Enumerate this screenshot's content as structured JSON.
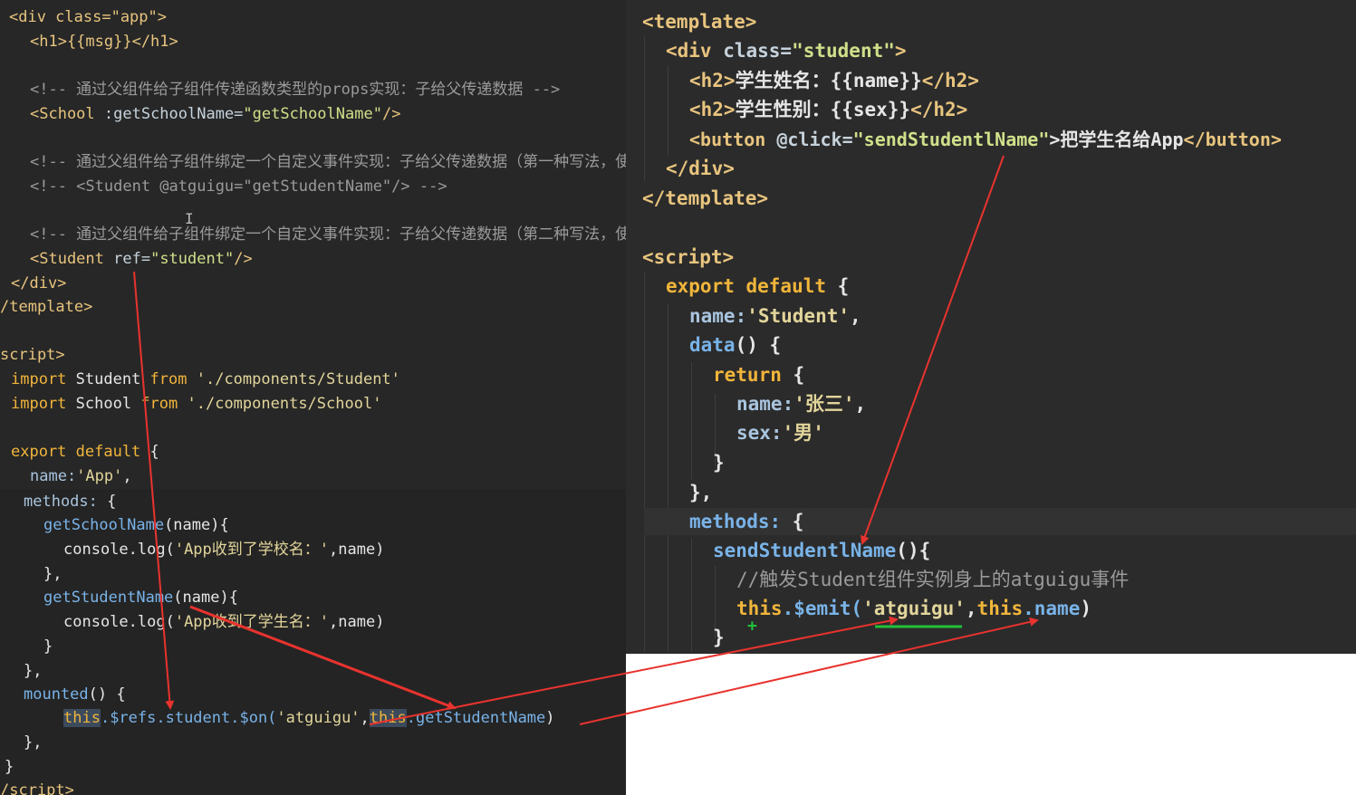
{
  "left_editor": {
    "l1": "<div class=\"app\">",
    "l2": "<h1>{{msg}}</h1>",
    "l3": "<!-- 通过父组件给子组件传递函数类型的props实现：子给父传递数据 -->",
    "l4a": "<School",
    "l4b": " :getSchoolName=",
    "l4c": "\"getSchoolName\"",
    "l4d": "/>",
    "l5": "<!-- 通过父组件给子组件绑定一个自定义事件实现：子给父传递数据（第一种写法，使用@或v-on） -->",
    "l6": "<!-- <Student @atguigu=\"getStudentName\"/> -->",
    "l7": "<!-- 通过父组件给子组件绑定一个自定义事件实现：子给父传递数据（第二种写法，使用ref） -->",
    "l8a": "<Student",
    "l8b": " ref=",
    "l8c": "\"student\"",
    "l8d": "/>",
    "l9": "</div>",
    "l10": "/template>",
    "l11": "script>",
    "l12a": "import",
    "l12b": " Student ",
    "l12c": "from",
    "l12d": " './components/Student'",
    "l13a": "import",
    "l13b": " School ",
    "l13c": "from",
    "l13d": " './components/School'",
    "l14a": "export default",
    "l14b": " {",
    "l15a": "name:",
    "l15b": "'App'",
    "l15c": ",",
    "l16a": "methods:",
    "l16b": " {",
    "l17a": "getSchoolName",
    "l17b": "(name){",
    "l18a": "console.log(",
    "l18b": "'App收到了学校名：'",
    "l18c": ",name)",
    "l19": "},",
    "l20a": "getStudentName",
    "l20b": "(name){",
    "l21a": "console.log(",
    "l21b": "'App收到了学生名：'",
    "l21c": ",name)",
    "l22": "}",
    "l23": "},",
    "l24a": "mounted",
    "l24b": "() {",
    "l25a": "this",
    "l25b": ".$refs.student.$on(",
    "l25c": "'atguigu'",
    "l25d": ",",
    "l25e": "this",
    "l25f": ".getStudentName",
    "l25g": ")",
    "l26": "},",
    "l27": "}",
    "l28": "/script>"
  },
  "right_editor": {
    "r1": "<template>",
    "r2a": "<div",
    "r2b": " class=",
    "r2c": "\"student\"",
    "r2d": ">",
    "r3a": "<h2>",
    "r3b": "学生姓名：{{name}}",
    "r3c": "</h2>",
    "r4a": "<h2>",
    "r4b": "学生性别：{{sex}}",
    "r4c": "</h2>",
    "r5a": "<button",
    "r5b": " @click=",
    "r5c": "\"sendStudentlName\"",
    "r5d": ">把学生名给App",
    "r5e": "</button>",
    "r6": "</div>",
    "r7": "</template>",
    "r8": "<script>",
    "r9a": "export default",
    "r9b": " {",
    "r10a": "name:",
    "r10b": "'Student'",
    "r10c": ",",
    "r11a": "data",
    "r11b": "() {",
    "r12a": "return",
    "r12b": " {",
    "r13a": "name:",
    "r13b": "'张三'",
    "r13c": ",",
    "r14a": "sex:",
    "r14b": "'男'",
    "r15": "}",
    "r16": "},",
    "r17a": "methods:",
    "r17b": " {",
    "r18a": "sendStudentlName",
    "r18b": "(){",
    "r19": "//触发Student组件实例身上的atguigu事件",
    "r20a": "this",
    "r20b": ".$emit(",
    "r20c": "'atguigu'",
    "r20d": ",",
    "r20e": "this",
    "r20f": ".name",
    "r20g": ")",
    "r21": "}"
  },
  "colors": {
    "arrow": "#e8332e",
    "underline": "#22c03a",
    "tag": "#e8c47e",
    "string": "#cfe08a",
    "keyword": "#f0b53b",
    "function": "#79b3e8",
    "comment": "#9a9a9a"
  }
}
